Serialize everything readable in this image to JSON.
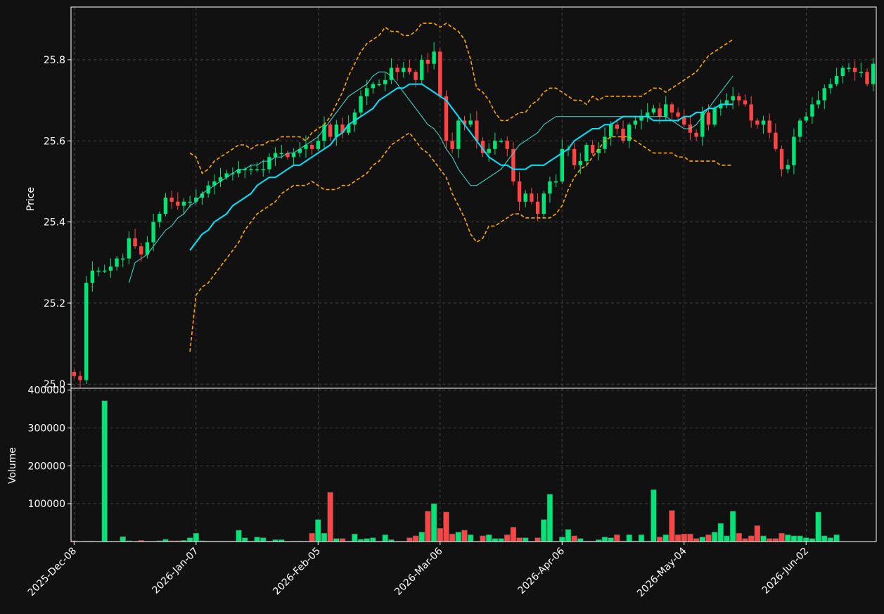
{
  "chart_data": {
    "type": "candlestick",
    "colors": {
      "background": "#111111",
      "up": "#00e676",
      "down": "#ff4444",
      "grid": "#444444",
      "sma_fast": "#3ee0d0",
      "sma_slow": "#00e5ff",
      "bands": "#ffa500"
    },
    "price_panel": {
      "ylabel": "Price",
      "ylim": [
        24.99,
        25.93
      ],
      "yticks": [
        "25.0",
        "25.2",
        "25.4",
        "25.6",
        "25.8"
      ],
      "grid": true
    },
    "volume_panel": {
      "ylabel": "Volume",
      "ylim": [
        0,
        405000
      ],
      "yticks": [
        "100000",
        "200000",
        "300000",
        "400000"
      ],
      "grid": true
    },
    "x_tick_labels": [
      "2025-Dec-08",
      "2026-Jan-07",
      "2026-Feb-05",
      "2026-Mar-06",
      "2026-Apr-06",
      "2026-May-04",
      "2026-Jun-02"
    ],
    "x_tick_index": [
      0,
      20,
      40,
      60,
      80,
      100,
      120
    ],
    "close": [
      25.02,
      25.01,
      25.25,
      25.28,
      25.28,
      25.28,
      25.29,
      25.31,
      25.31,
      25.36,
      25.34,
      25.32,
      25.35,
      25.4,
      25.42,
      25.46,
      25.45,
      25.44,
      25.45,
      25.45,
      25.46,
      25.47,
      25.49,
      25.5,
      25.51,
      25.52,
      25.52,
      25.53,
      25.53,
      25.53,
      25.53,
      25.53,
      25.56,
      25.57,
      25.57,
      25.56,
      25.57,
      25.58,
      25.59,
      25.58,
      25.6,
      25.64,
      25.61,
      25.64,
      25.62,
      25.64,
      25.67,
      25.71,
      25.73,
      25.74,
      25.74,
      25.75,
      25.78,
      25.77,
      25.78,
      25.77,
      25.75,
      25.8,
      25.79,
      25.82,
      25.71,
      25.6,
      25.58,
      25.65,
      25.64,
      25.65,
      25.6,
      25.57,
      25.58,
      25.6,
      25.6,
      25.58,
      25.5,
      25.45,
      25.47,
      25.45,
      25.42,
      25.47,
      25.5,
      25.5,
      25.58,
      25.58,
      25.54,
      25.55,
      25.59,
      25.57,
      25.58,
      25.61,
      25.64,
      25.63,
      25.6,
      25.64,
      25.65,
      25.66,
      25.67,
      25.68,
      25.66,
      25.69,
      25.67,
      25.66,
      25.64,
      25.62,
      25.61,
      25.67,
      25.64,
      25.68,
      25.69,
      25.7,
      25.71,
      25.7,
      25.69,
      25.65,
      25.64,
      25.65,
      25.62,
      25.58,
      25.53,
      25.54,
      25.61,
      25.65,
      25.66,
      25.69,
      25.7,
      25.73,
      25.74,
      25.76,
      25.78,
      25.78,
      25.77,
      25.77,
      25.74,
      25.79
    ],
    "volume": [
      2000,
      1000,
      1500,
      1500,
      1000,
      372000,
      1000,
      1000,
      13000,
      2000,
      1000,
      3000,
      1000,
      1000,
      2000,
      6000,
      2000,
      2000,
      3000,
      10000,
      22000,
      2000,
      1500,
      1500,
      1500,
      1500,
      1500,
      30000,
      10000,
      1500,
      12000,
      10000,
      1500,
      5000,
      5000,
      1000,
      1500,
      1500,
      1000,
      22000,
      58000,
      22000,
      130000,
      8000,
      8000,
      1500,
      20000,
      6000,
      8000,
      10000,
      1500,
      18000,
      5000,
      1000,
      1000,
      10000,
      15000,
      25000,
      80000,
      100000,
      35000,
      78000,
      20000,
      25000,
      30000,
      18000,
      1000,
      15000,
      18000,
      8000,
      8000,
      18000,
      38000,
      10000,
      10000,
      1000,
      10000,
      58000,
      125000,
      1000,
      12000,
      32000,
      15000,
      8000,
      1500,
      1500,
      5000,
      12000,
      10000,
      18000,
      1500,
      18000,
      1500,
      18000,
      1500,
      137000,
      12000,
      18000,
      82000,
      18000,
      20000,
      20000,
      8000,
      12000,
      18000,
      25000,
      48000,
      15000,
      80000,
      22000,
      8000,
      15000,
      42000,
      15000,
      8000,
      8000,
      22000,
      18000,
      15000,
      15000,
      10000,
      8000,
      78000,
      15000,
      10000,
      18000
    ],
    "sma_fast": {
      "name": "",
      "start": 9,
      "values": [
        25.25,
        25.3,
        25.31,
        25.32,
        25.34,
        25.36,
        25.38,
        25.39,
        25.41,
        25.42,
        25.44,
        25.45,
        25.47,
        25.48,
        25.49,
        25.5,
        25.51,
        25.52,
        25.53,
        25.53,
        25.54,
        25.54,
        25.55,
        25.55,
        25.56,
        25.56,
        25.57,
        25.57,
        25.58,
        25.59,
        25.6,
        25.61,
        25.63,
        25.65,
        25.67,
        25.69,
        25.71,
        25.72,
        25.73,
        25.74,
        25.76,
        25.77,
        25.77,
        25.76,
        25.74,
        25.72,
        25.7,
        25.68,
        25.66,
        25.64,
        25.63,
        25.61,
        25.58,
        25.56,
        25.53,
        25.51,
        25.49,
        25.49,
        25.5,
        25.51,
        25.52,
        25.53,
        25.55,
        25.57,
        25.59,
        25.6,
        25.61,
        25.62,
        25.64,
        25.65,
        25.66,
        25.66,
        25.66,
        25.66,
        25.66,
        25.66,
        25.66,
        25.66,
        25.66,
        25.66,
        25.66,
        25.66,
        25.66,
        25.66,
        25.66,
        25.66,
        25.66,
        25.66,
        25.66,
        25.65,
        25.64,
        25.63,
        25.63,
        25.64,
        25.66,
        25.68,
        25.7,
        25.72,
        25.74,
        25.76
      ]
    },
    "sma_slow": {
      "name": "",
      "start": 19,
      "values": [
        25.33,
        25.35,
        25.37,
        25.38,
        25.4,
        25.41,
        25.42,
        25.44,
        25.45,
        25.46,
        25.47,
        25.49,
        25.5,
        25.51,
        25.51,
        25.52,
        25.53,
        25.54,
        25.54,
        25.55,
        25.56,
        25.57,
        25.58,
        25.59,
        25.61,
        25.62,
        25.64,
        25.65,
        25.66,
        25.67,
        25.68,
        25.7,
        25.71,
        25.72,
        25.73,
        25.73,
        25.74,
        25.74,
        25.74,
        25.73,
        25.72,
        25.71,
        25.7,
        25.68,
        25.66,
        25.64,
        25.62,
        25.6,
        25.58,
        25.56,
        25.55,
        25.54,
        25.54,
        25.53,
        25.53,
        25.53,
        25.54,
        25.54,
        25.54,
        25.55,
        25.56,
        25.57,
        25.58,
        25.6,
        25.61,
        25.62,
        25.63,
        25.63,
        25.64,
        25.64,
        25.65,
        25.66,
        25.66,
        25.66,
        25.66,
        25.66,
        25.65,
        25.65,
        25.65,
        25.65,
        25.65,
        25.66,
        25.66,
        25.67,
        25.67,
        25.68,
        25.68,
        25.69,
        25.69,
        25.69
      ]
    },
    "upper_band": {
      "name": "",
      "start": 19,
      "values": [
        25.57,
        25.56,
        25.52,
        25.53,
        25.55,
        25.56,
        25.57,
        25.58,
        25.59,
        25.59,
        25.58,
        25.59,
        25.59,
        25.6,
        25.6,
        25.61,
        25.61,
        25.61,
        25.61,
        25.6,
        25.62,
        25.63,
        25.64,
        25.66,
        25.69,
        25.72,
        25.76,
        25.79,
        25.82,
        25.84,
        25.85,
        25.86,
        25.88,
        25.87,
        25.87,
        25.86,
        25.86,
        25.87,
        25.89,
        25.89,
        25.89,
        25.88,
        25.89,
        25.88,
        25.87,
        25.85,
        25.8,
        25.73,
        25.72,
        25.7,
        25.67,
        25.65,
        25.65,
        25.66,
        25.67,
        25.67,
        25.69,
        25.7,
        25.72,
        25.73,
        25.73,
        25.72,
        25.71,
        25.7,
        25.7,
        25.69,
        25.71,
        25.7,
        25.71,
        25.71,
        25.71,
        25.71,
        25.71,
        25.71,
        25.71,
        25.72,
        25.73,
        25.73,
        25.72,
        25.73,
        25.74,
        25.75,
        25.76,
        25.77,
        25.79,
        25.81,
        25.82,
        25.83,
        25.84,
        25.85
      ]
    },
    "lower_band": {
      "name": "",
      "start": 19,
      "values": [
        25.08,
        25.22,
        25.24,
        25.25,
        25.27,
        25.29,
        25.31,
        25.33,
        25.35,
        25.38,
        25.4,
        25.42,
        25.43,
        25.44,
        25.45,
        25.47,
        25.48,
        25.49,
        25.49,
        25.49,
        25.5,
        25.49,
        25.48,
        25.48,
        25.48,
        25.49,
        25.49,
        25.5,
        25.51,
        25.52,
        25.54,
        25.55,
        25.57,
        25.59,
        25.6,
        25.61,
        25.62,
        25.6,
        25.58,
        25.57,
        25.55,
        25.53,
        25.51,
        25.47,
        25.44,
        25.41,
        25.37,
        25.35,
        25.36,
        25.39,
        25.39,
        25.4,
        25.41,
        25.42,
        25.42,
        25.41,
        25.41,
        25.41,
        25.41,
        25.41,
        25.42,
        25.44,
        25.48,
        25.51,
        25.53,
        25.54,
        25.56,
        25.58,
        25.6,
        25.61,
        25.61,
        25.61,
        25.61,
        25.6,
        25.59,
        25.58,
        25.57,
        25.57,
        25.57,
        25.57,
        25.56,
        25.56,
        25.55,
        25.55,
        25.55,
        25.55,
        25.55,
        25.54,
        25.54,
        25.54
      ]
    }
  }
}
